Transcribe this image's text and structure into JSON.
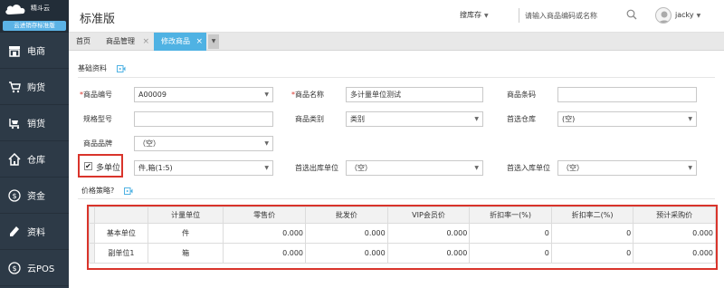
{
  "brand": {
    "name": "精斗云",
    "edition_badge": "云进销存标准版"
  },
  "sidebar": {
    "items": [
      {
        "label": "电商",
        "icon": "store-icon"
      },
      {
        "label": "购货",
        "icon": "cart-icon"
      },
      {
        "label": "销货",
        "icon": "cart-out-icon"
      },
      {
        "label": "仓库",
        "icon": "house-icon"
      },
      {
        "label": "资金",
        "icon": "dollar-icon"
      },
      {
        "label": "资料",
        "icon": "pencil-icon"
      },
      {
        "label": "云POS",
        "icon": "dollar-icon"
      }
    ]
  },
  "header": {
    "title": "标准版",
    "search_scope": "搜库存",
    "search_placeholder": "请输入商品编码或名称",
    "username": "jacky"
  },
  "tabs": [
    {
      "label": "首页",
      "closable": false,
      "active": false
    },
    {
      "label": "商品管理",
      "closable": true,
      "active": false
    },
    {
      "label": "修改商品",
      "closable": true,
      "active": true
    }
  ],
  "basic": {
    "section_title": "基础资料",
    "product_code_label": "商品编号",
    "product_code_value": "A00009",
    "product_name_label": "商品名称",
    "product_name_value": "多计量单位测试",
    "barcode_label": "商品条码",
    "barcode_value": "",
    "spec_label": "规格型号",
    "spec_value": "",
    "category_label": "商品类别",
    "category_value": "类别",
    "preferred_warehouse_label": "首选仓库",
    "preferred_warehouse_value": "(空)",
    "brand_label": "商品品牌",
    "brand_value": "（空）",
    "multi_unit_label": "多单位",
    "multi_unit_checked": true,
    "unit_value": "件,箱(1:5)",
    "out_unit_label": "首选出库单位",
    "out_unit_value": "（空）",
    "in_unit_label": "首选入库单位",
    "in_unit_value": "（空）"
  },
  "pricing": {
    "section_title": "价格策略?",
    "columns": [
      "",
      "计量单位",
      "零售价",
      "批发价",
      "VIP会员价",
      "折扣率一(%)",
      "折扣率二(%)",
      "预计采购价"
    ],
    "rows": [
      [
        "基本单位",
        "件",
        "0.000",
        "0.000",
        "0.000",
        "0",
        "0",
        "0.000"
      ],
      [
        "副单位1",
        "箱",
        "0.000",
        "0.000",
        "0.000",
        "0",
        "0",
        "0.000"
      ]
    ]
  },
  "colors": {
    "sidebar_bg": "#2d3a47",
    "accent": "#4fb2e3",
    "highlight": "#d9342b",
    "required": "#d9342b"
  }
}
